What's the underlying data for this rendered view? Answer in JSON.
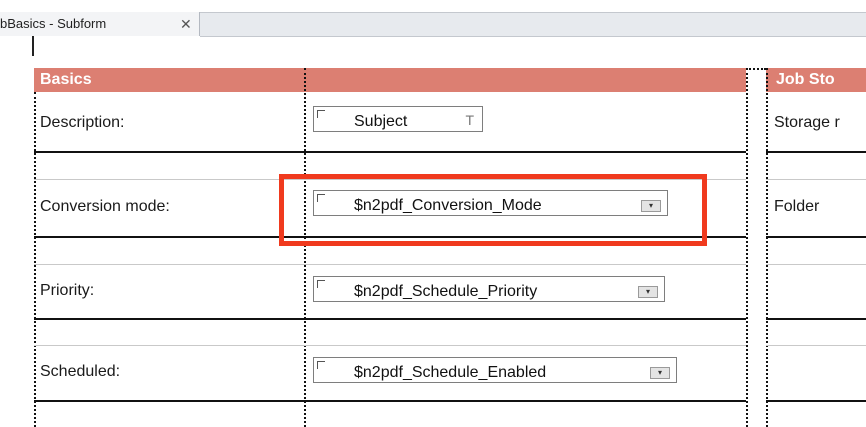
{
  "tab": {
    "title": "bBasics - Subform",
    "close_glyph": "✕"
  },
  "sections": {
    "basics_title": "Basics",
    "job_title": "Job Sto"
  },
  "rows": [
    {
      "label": "Description:",
      "field": "Subject",
      "field_kind": "text",
      "right_label": "Storage r"
    },
    {
      "label": "Conversion mode:",
      "field": "$n2pdf_Conversion_Mode",
      "field_kind": "dropdown",
      "right_label": "Folder"
    },
    {
      "label": "Priority:",
      "field": "$n2pdf_Schedule_Priority",
      "field_kind": "dropdown",
      "right_label": ""
    },
    {
      "label": "Scheduled:",
      "field": "$n2pdf_Schedule_Enabled",
      "field_kind": "dropdown",
      "right_label": ""
    }
  ],
  "icons": {
    "text_field": "T",
    "dropdown": "▾"
  },
  "colors": {
    "header_bg": "#dc7f72",
    "highlight": "#f03a1e"
  }
}
